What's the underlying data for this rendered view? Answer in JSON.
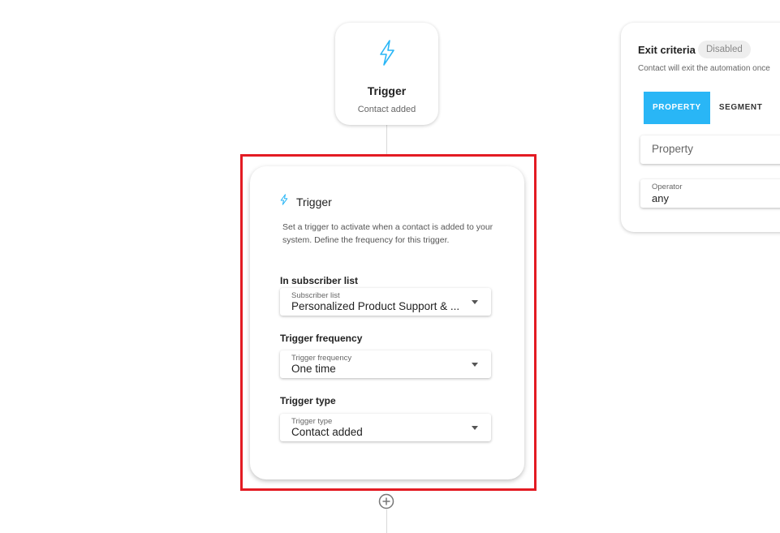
{
  "trigger_node": {
    "title": "Trigger",
    "subtitle": "Contact added"
  },
  "trigger_panel": {
    "title": "Trigger",
    "description": "Set a trigger to activate when a contact is added to your system. Define the frequency for this trigger.",
    "subscriber_list": {
      "section_label": "In subscriber list",
      "field_label": "Subscriber list",
      "value": "Personalized Product Support & ..."
    },
    "frequency": {
      "section_label": "Trigger frequency",
      "field_label": "Trigger frequency",
      "value": "One time"
    },
    "type": {
      "section_label": "Trigger type",
      "field_label": "Trigger type",
      "value": "Contact added"
    }
  },
  "exit_criteria": {
    "title": "Exit criteria",
    "badge": "Disabled",
    "description": "Contact will exit the automation once",
    "tabs": [
      "PROPERTY",
      "SEGMENT",
      "E"
    ],
    "property_placeholder": "Property",
    "operator_label": "Operator",
    "operator_value": "any"
  },
  "icons": {
    "trigger": "lightning-bolt-icon",
    "add": "plus-circle-icon",
    "dropdown": "caret-down-icon"
  },
  "colors": {
    "accent": "#29b6f6",
    "highlight": "#e31b23"
  }
}
